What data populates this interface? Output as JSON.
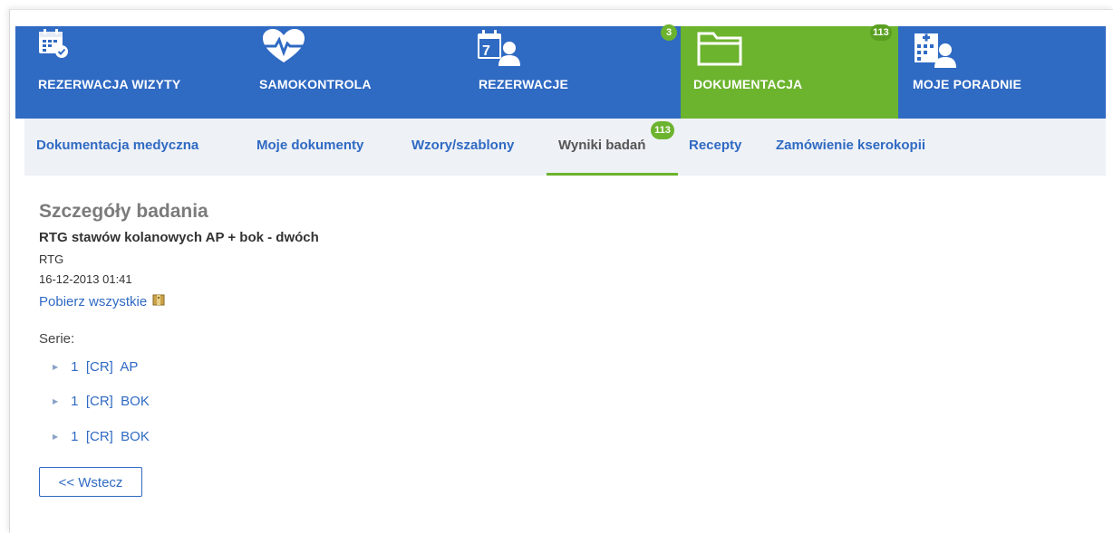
{
  "top_nav": [
    {
      "label": "REZERWACJA WIZYTY",
      "icon": "calendar-check-icon",
      "badge": ""
    },
    {
      "label": "SAMOKONTROLA",
      "icon": "heart-pulse-icon",
      "badge": ""
    },
    {
      "label": "REZERWACJE",
      "icon": "calendar-person-icon",
      "badge": "3"
    },
    {
      "label": "DOKUMENTACJA",
      "icon": "folder-icon",
      "badge": "113",
      "active": true
    },
    {
      "label": "MOJE PORADNIE",
      "icon": "hospital-person-icon",
      "badge": ""
    }
  ],
  "sub_nav": [
    {
      "label": "Dokumentacja medyczna"
    },
    {
      "label": "Moje dokumenty"
    },
    {
      "label": "Wzory/szablony"
    },
    {
      "label": "Wyniki badań",
      "badge": "113",
      "active": true
    },
    {
      "label": "Recepty"
    },
    {
      "label": "Zamówienie kserokopii"
    }
  ],
  "detail": {
    "title": "Szczegóły badania",
    "exam_name": "RTG stawów kolanowych AP + bok - dwóch",
    "modality": "RTG",
    "datetime": "16-12-2013 01:41",
    "download_all": "Pobierz wszystkie",
    "series_label": "Serie:",
    "series": [
      {
        "label": "1  [CR]  AP"
      },
      {
        "label": "1  [CR]  BOK"
      },
      {
        "label": "1  [CR]  BOK"
      }
    ],
    "back_button": "<< Wstecz"
  },
  "colors": {
    "nav_blue": "#2f6ac3",
    "accent_green": "#6cb32e",
    "subnav_bg": "#eef1f6"
  }
}
